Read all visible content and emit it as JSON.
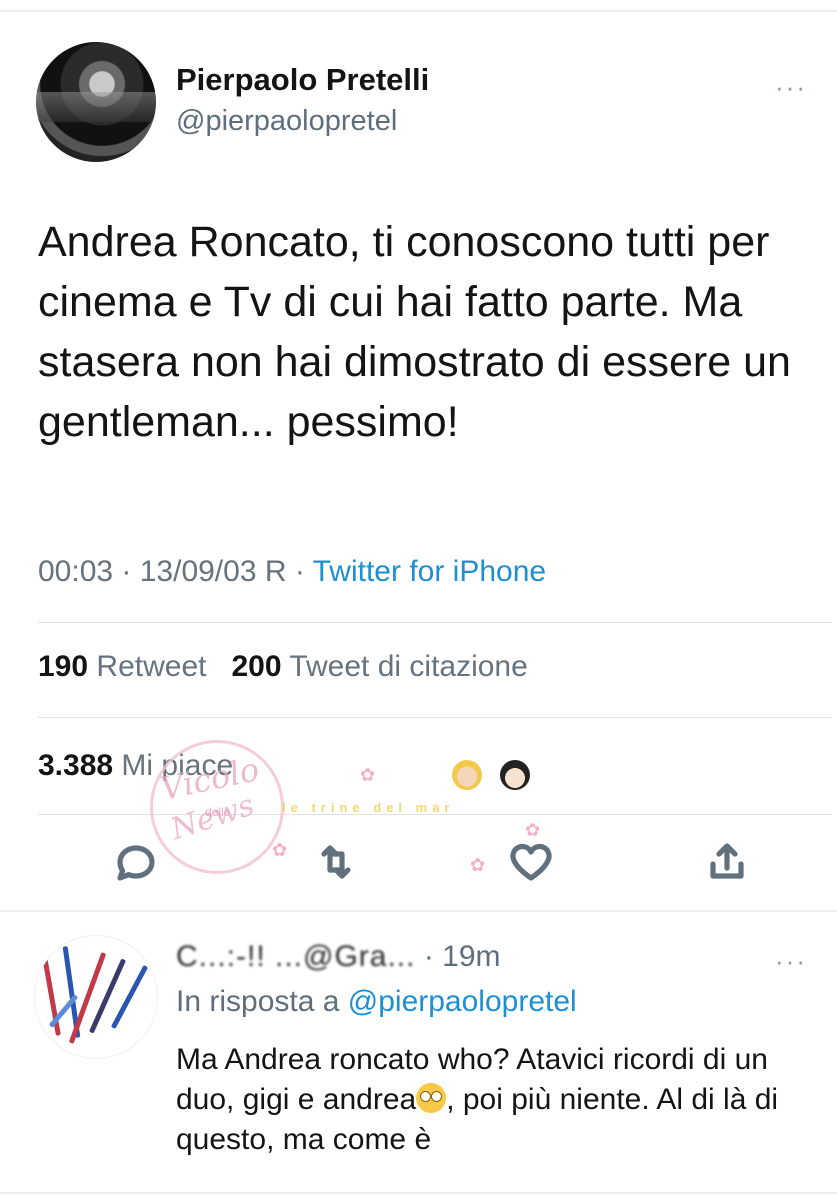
{
  "tweet": {
    "author_name": "Pierpaolo Pretelli",
    "author_handle": "@pierpaolopretel",
    "more_icon": "···",
    "text": "Andrea Roncato, ti conoscono tutti per cinema e Tv di cui hai fatto parte. Ma stasera non hai dimostrato di essere un gentleman... pessimo!",
    "timestamp": "00:03 · 13/09/03 R · ",
    "source": "Twitter for iPhone",
    "retweets_count": "190",
    "retweets_label": "Retweet",
    "quotes_count": "200",
    "quotes_label": "Tweet di citazione",
    "likes_count": "3.388",
    "likes_label": "Mi piace"
  },
  "actions": [
    {
      "icon": "reply-icon"
    },
    {
      "icon": "retweet-icon"
    },
    {
      "icon": "like-icon"
    },
    {
      "icon": "share-icon"
    }
  ],
  "reply": {
    "author_obscured": "C...:-!! ...@Gra...",
    "time": " · 19m",
    "more_icon": "···",
    "reply_prefix": "In risposta a ",
    "reply_mention": "@pierpaolopretel",
    "text_part1": "Ma Andrea roncato who? Atavici ricordi di un duo, gigi e andrea",
    "text_part2": ", poi più niente. Al di là di questo, ma come è"
  },
  "watermark": {
    "line1": "Vicolo",
    "line2": "delle",
    "line3": "News",
    "banner": "le trine del mar"
  },
  "colors": {
    "link": "#1d8fd2",
    "secondary": "#66737f",
    "primary_text": "#141414"
  }
}
